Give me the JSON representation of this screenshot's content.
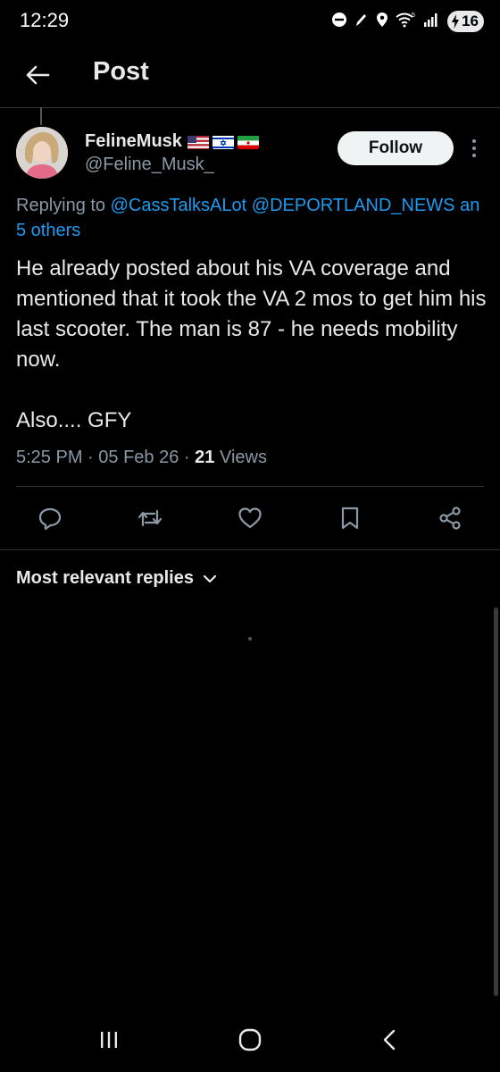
{
  "status_bar": {
    "time": "12:29",
    "battery": "16",
    "icons": [
      "do-not-disturb-icon",
      "pen-icon",
      "location-icon",
      "wifi-icon",
      "signal-icon",
      "battery-charging-icon"
    ]
  },
  "header": {
    "title": "Post",
    "back_icon": "back-arrow-icon"
  },
  "post": {
    "author_name": "FelineMusk",
    "author_handle": "@Feline_Musk_",
    "flags": [
      "us-flag-icon",
      "israel-flag-icon",
      "iran-flag-icon"
    ],
    "follow_label": "Follow",
    "replying_prefix": "Replying to ",
    "replying_to": [
      "@CassTalksALot",
      "@DEPORTLAND_NEWS"
    ],
    "replying_suffix": "an",
    "replying_others": "5 others",
    "body_lines": [
      "He already posted about his VA coverage and mentioned that it took the VA 2 mos to get him his last scooter.  The man is 87 - he needs mobility now.",
      "Also.... GFY"
    ],
    "time": "5:25 PM",
    "date": "05 Feb 26",
    "separator": "·",
    "views_count": "21",
    "views_label": "Views"
  },
  "actions": [
    "reply-icon",
    "repost-icon",
    "like-icon",
    "bookmark-icon",
    "share-icon"
  ],
  "replies": {
    "sort_label": "Most relevant replies"
  },
  "colors": {
    "background": "#000000",
    "text": "#e7e9ea",
    "secondary": "#8b98a5",
    "link": "#1d9bf0",
    "divider": "#2f3336"
  }
}
